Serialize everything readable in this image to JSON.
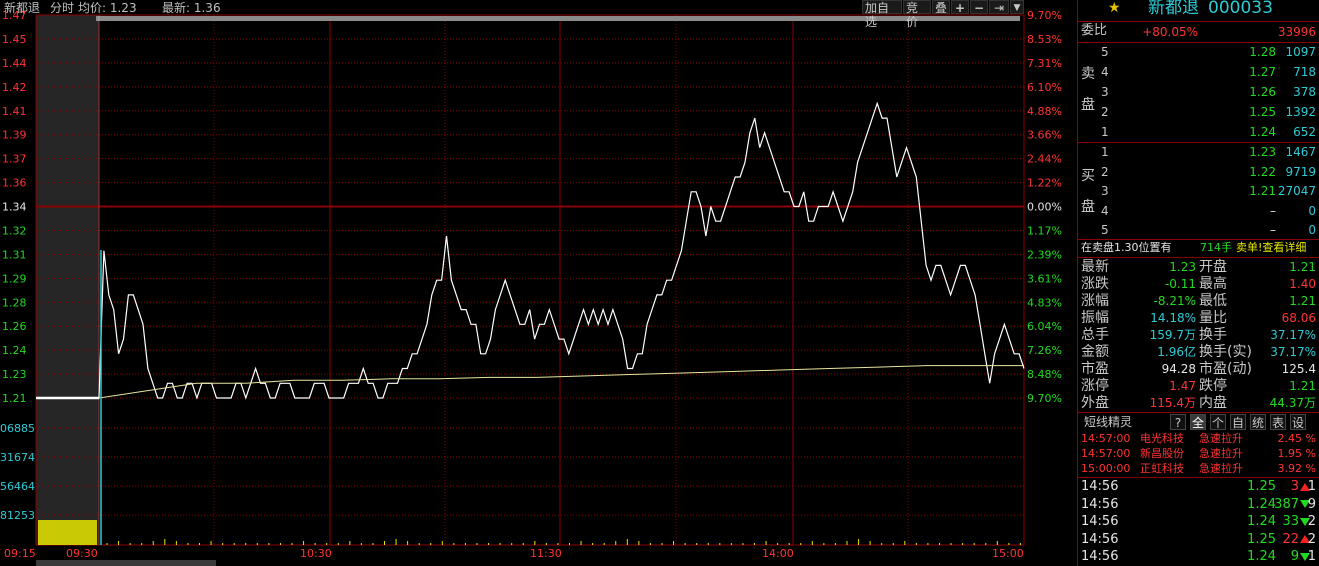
{
  "header": {
    "name": "新都退",
    "mode": "分时",
    "avg_label": "均价: 1.23",
    "latest_label": "最新: 1.36",
    "buttons": [
      "加自选",
      "竞价",
      "叠"
    ]
  },
  "colors": {
    "grid": "#8b0000",
    "price": "#ffffff",
    "avg": "#e6e6a0",
    "red": "#ff3333",
    "green": "#22d922",
    "cyan": "#2ecbd6",
    "volume": "#e6e600"
  },
  "chart_data": {
    "type": "line",
    "x_ticks": [
      "09:15",
      "09:30",
      "10:30",
      "11:30",
      "14:00",
      "15:00"
    ],
    "y_left_ticks": [
      "1.47",
      "1.45",
      "1.44",
      "1.42",
      "1.41",
      "1.39",
      "1.37",
      "1.36",
      "1.34",
      "1.32",
      "1.31",
      "1.29",
      "1.28",
      "1.26",
      "1.24",
      "1.23",
      "1.21"
    ],
    "y_right_ticks": [
      "9.70%",
      "8.53%",
      "7.31%",
      "6.10%",
      "4.88%",
      "3.66%",
      "2.44%",
      "1.22%",
      "0.00%",
      "1.17%",
      "2.39%",
      "3.61%",
      "4.83%",
      "6.04%",
      "7.26%",
      "8.48%",
      "9.70%"
    ],
    "ylim": [
      1.21,
      1.47
    ],
    "prev_close": 1.34,
    "volume_ticks": [
      "06885",
      "31674",
      "56464",
      "81253"
    ],
    "price_series": [
      1.21,
      1.31,
      1.28,
      1.27,
      1.24,
      1.25,
      1.28,
      1.28,
      1.27,
      1.26,
      1.23,
      1.22,
      1.21,
      1.21,
      1.22,
      1.22,
      1.21,
      1.21,
      1.22,
      1.22,
      1.21,
      1.22,
      1.22,
      1.22,
      1.21,
      1.21,
      1.21,
      1.21,
      1.22,
      1.22,
      1.21,
      1.22,
      1.23,
      1.22,
      1.22,
      1.21,
      1.21,
      1.22,
      1.22,
      1.22,
      1.21,
      1.21,
      1.21,
      1.21,
      1.22,
      1.22,
      1.22,
      1.21,
      1.21,
      1.21,
      1.21,
      1.22,
      1.22,
      1.22,
      1.23,
      1.22,
      1.22,
      1.21,
      1.21,
      1.22,
      1.22,
      1.22,
      1.23,
      1.23,
      1.24,
      1.24,
      1.25,
      1.26,
      1.28,
      1.29,
      1.29,
      1.32,
      1.29,
      1.28,
      1.27,
      1.27,
      1.26,
      1.26,
      1.24,
      1.24,
      1.25,
      1.27,
      1.28,
      1.29,
      1.28,
      1.27,
      1.26,
      1.26,
      1.27,
      1.25,
      1.26,
      1.26,
      1.27,
      1.26,
      1.25,
      1.25,
      1.24,
      1.25,
      1.26,
      1.27,
      1.26,
      1.27,
      1.26,
      1.27,
      1.26,
      1.27,
      1.26,
      1.25,
      1.23,
      1.23,
      1.24,
      1.24,
      1.26,
      1.27,
      1.28,
      1.28,
      1.29,
      1.29,
      1.3,
      1.31,
      1.33,
      1.35,
      1.35,
      1.34,
      1.32,
      1.34,
      1.33,
      1.33,
      1.34,
      1.35,
      1.36,
      1.36,
      1.37,
      1.39,
      1.4,
      1.38,
      1.39,
      1.38,
      1.37,
      1.36,
      1.35,
      1.35,
      1.34,
      1.34,
      1.35,
      1.33,
      1.33,
      1.34,
      1.34,
      1.34,
      1.35,
      1.34,
      1.33,
      1.34,
      1.35,
      1.37,
      1.38,
      1.39,
      1.4,
      1.41,
      1.4,
      1.4,
      1.38,
      1.36,
      1.37,
      1.38,
      1.37,
      1.36,
      1.33,
      1.3,
      1.29,
      1.3,
      1.3,
      1.29,
      1.28,
      1.29,
      1.3,
      1.3,
      1.29,
      1.28,
      1.26,
      1.24,
      1.22,
      1.24,
      1.25,
      1.26,
      1.25,
      1.24,
      1.24,
      1.23
    ],
    "avg_series": [
      1.21,
      1.215,
      1.22,
      1.22,
      1.222,
      1.222,
      1.223,
      1.223,
      1.224,
      1.224,
      1.225,
      1.226,
      1.227,
      1.228,
      1.229,
      1.23,
      1.231,
      1.232,
      1.232,
      1.232
    ],
    "volume_series": [
      1,
      2,
      1,
      1,
      2,
      3,
      2,
      1,
      1,
      2,
      1,
      1,
      1,
      1,
      1,
      1,
      1,
      2,
      1,
      1
    ]
  },
  "panel": {
    "title": "新都退",
    "code": "000033",
    "weibi_label": "委比",
    "weibi_pct": "+80.05%",
    "weibi_val": "33996",
    "sell_label_1": "卖",
    "sell_label_2": "盘",
    "buy_label_1": "买",
    "buy_label_2": "盘",
    "sell": [
      {
        "lv": "5",
        "price": "1.28",
        "vol": "1097"
      },
      {
        "lv": "4",
        "price": "1.27",
        "vol": "718"
      },
      {
        "lv": "3",
        "price": "1.26",
        "vol": "378"
      },
      {
        "lv": "2",
        "price": "1.25",
        "vol": "1392"
      },
      {
        "lv": "1",
        "price": "1.24",
        "vol": "652"
      }
    ],
    "buy": [
      {
        "lv": "1",
        "price": "1.23",
        "vol": "1467"
      },
      {
        "lv": "2",
        "price": "1.22",
        "vol": "9719"
      },
      {
        "lv": "3",
        "price": "1.21",
        "vol": "27047"
      },
      {
        "lv": "4",
        "price": "–",
        "vol": "0"
      },
      {
        "lv": "5",
        "price": "–",
        "vol": "0"
      }
    ],
    "notice_a": "在卖盘1.30位置有",
    "notice_b": "714手",
    "notice_c": "卖单!查看详细",
    "stats": [
      {
        "l1": "最新",
        "v1": "1.23",
        "c1": "green",
        "l2": "开盘",
        "v2": "1.21",
        "c2": "green"
      },
      {
        "l1": "涨跌",
        "v1": "-0.11",
        "c1": "green",
        "l2": "最高",
        "v2": "1.40",
        "c2": "red"
      },
      {
        "l1": "涨幅",
        "v1": "-8.21%",
        "c1": "green",
        "l2": "最低",
        "v2": "1.21",
        "c2": "green"
      },
      {
        "l1": "振幅",
        "v1": "14.18%",
        "c1": "cyan",
        "l2": "量比",
        "v2": "68.06",
        "c2": "red"
      },
      {
        "l1": "总手",
        "v1": "159.7万",
        "c1": "cyan",
        "l2": "换手",
        "v2": "37.17%",
        "c2": "cyan"
      },
      {
        "l1": "金额",
        "v1": "1.96亿",
        "c1": "cyan",
        "l2": "换手(实)",
        "v2": "37.17%",
        "c2": "cyan"
      },
      {
        "l1": "市盈",
        "v1": "94.28",
        "c1": "white",
        "l2": "市盈(动)",
        "v2": "125.4",
        "c2": "white"
      },
      {
        "l1": "涨停",
        "v1": "1.47",
        "c1": "red",
        "l2": "跌停",
        "v2": "1.21",
        "c2": "green"
      },
      {
        "l1": "外盘",
        "v1": "115.4万",
        "c1": "red",
        "l2": "内盘",
        "v2": "44.37万",
        "c2": "green"
      }
    ],
    "tabs_title": "短线精灵",
    "tabs": [
      "?",
      "全",
      "个",
      "自",
      "统",
      "表",
      "设"
    ],
    "alerts": [
      {
        "time": "14:57:00",
        "name": "电光科技",
        "type": "急速拉升",
        "pct": "2.45 %"
      },
      {
        "time": "14:57:00",
        "name": "新昌股份",
        "type": "急速拉升",
        "pct": "1.95 %"
      },
      {
        "time": "15:00:00",
        "name": "正虹科技",
        "type": "急速拉升",
        "pct": "3.92 %"
      }
    ],
    "ticks": [
      {
        "time": "14:56",
        "price": "1.25",
        "vol": "3",
        "dir": "up",
        "n": "1"
      },
      {
        "time": "14:56",
        "price": "1.24",
        "vol": "387",
        "dir": "dn",
        "n": "9"
      },
      {
        "time": "14:56",
        "price": "1.24",
        "vol": "33",
        "dir": "dn",
        "n": "2"
      },
      {
        "time": "14:56",
        "price": "1.25",
        "vol": "22",
        "dir": "up",
        "n": "2"
      },
      {
        "time": "14:56",
        "price": "1.24",
        "vol": "9",
        "dir": "dn",
        "n": "1"
      }
    ]
  }
}
